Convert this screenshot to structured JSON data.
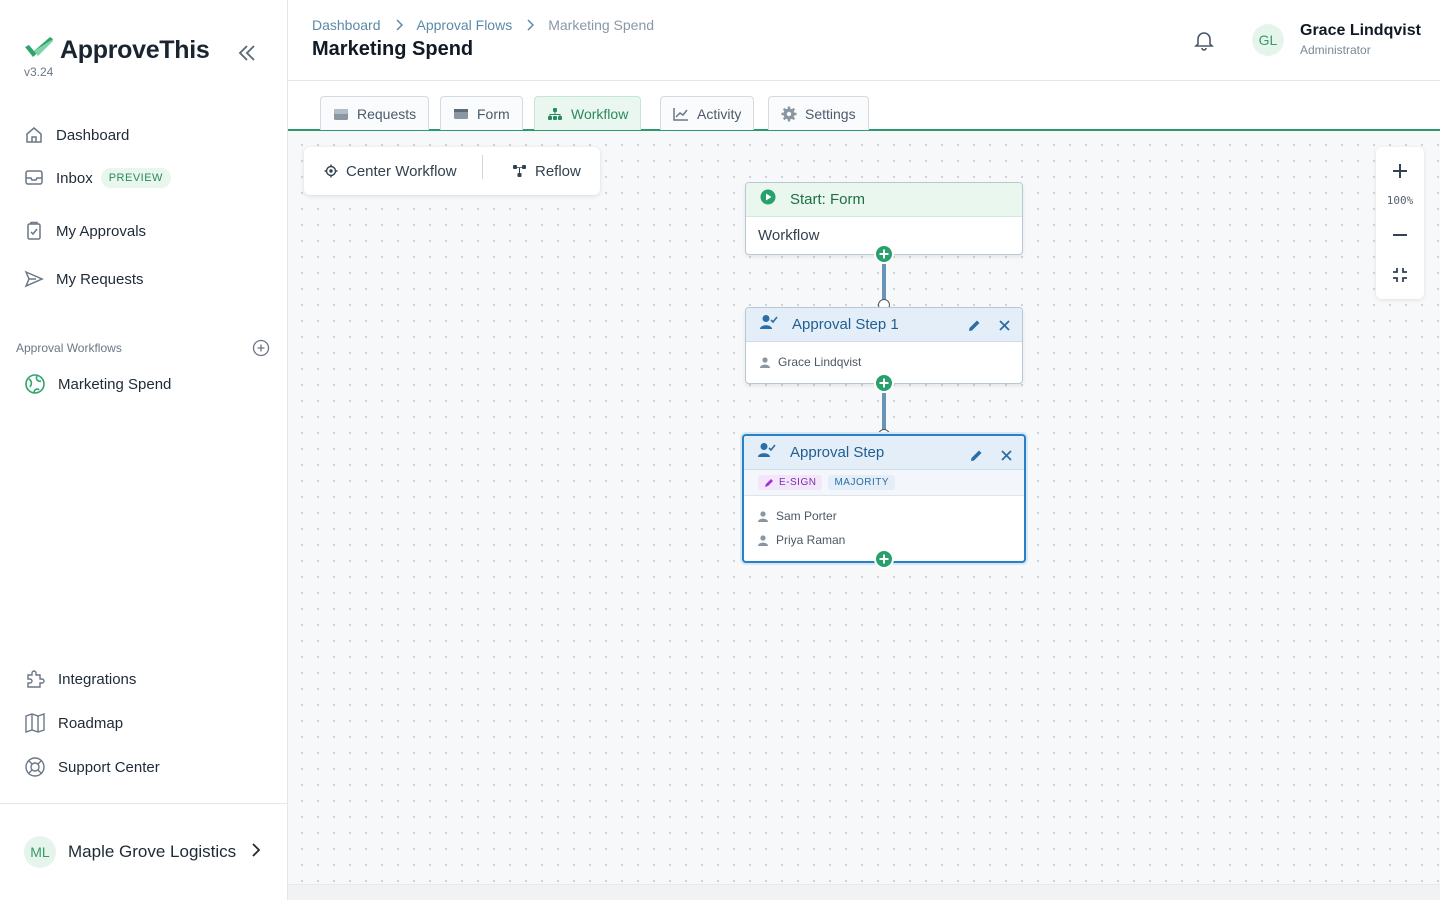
{
  "app": {
    "name": "ApproveThis",
    "version": "v3.24"
  },
  "sidebar": {
    "nav": [
      {
        "label": "Dashboard",
        "icon": "home-icon"
      },
      {
        "label": "Inbox",
        "icon": "inbox-icon",
        "badge": "PREVIEW"
      },
      {
        "label": "My Approvals",
        "icon": "clipboard-check-icon"
      },
      {
        "label": "My Requests",
        "icon": "send-icon"
      }
    ],
    "section_label": "Approval Workflows",
    "workflows": [
      {
        "label": "Marketing Spend",
        "icon": "globe-icon"
      }
    ],
    "footer_nav": [
      {
        "label": "Integrations",
        "icon": "puzzle-icon"
      },
      {
        "label": "Roadmap",
        "icon": "map-icon"
      },
      {
        "label": "Support Center",
        "icon": "lifebuoy-icon"
      }
    ],
    "org": {
      "initials": "ML",
      "name": "Maple Grove Logistics"
    }
  },
  "header": {
    "breadcrumbs": [
      "Dashboard",
      "Approval Flows",
      "Marketing Spend"
    ],
    "title": "Marketing Spend",
    "user": {
      "initials": "GL",
      "name": "Grace Lindqvist",
      "role": "Administrator"
    }
  },
  "tabs": [
    {
      "label": "Requests",
      "icon": "inbox-tray-icon"
    },
    {
      "label": "Form",
      "icon": "form-icon"
    },
    {
      "label": "Workflow",
      "icon": "sitemap-icon",
      "active": true
    },
    {
      "label": "Activity",
      "icon": "chart-line-icon"
    },
    {
      "label": "Settings",
      "icon": "gear-icon"
    }
  ],
  "toolbar": {
    "center": "Center Workflow",
    "reflow": "Reflow"
  },
  "zoom": {
    "level": "100%"
  },
  "workflow": {
    "start": {
      "title": "Start: Form",
      "body": "Workflow"
    },
    "step1": {
      "title": "Approval Step 1",
      "approvers": [
        "Grace Lindqvist"
      ]
    },
    "step2": {
      "title": "Approval Step",
      "tags": [
        "E-SIGN",
        "MAJORITY"
      ],
      "approvers": [
        "Sam Porter",
        "Priya Raman"
      ]
    }
  },
  "colors": {
    "accent": "#2b9a6e",
    "step_header": "#e4eef8",
    "start_header": "#e9f7ef",
    "edge": "#6a93b5",
    "selected_border": "#2b7fc3"
  }
}
